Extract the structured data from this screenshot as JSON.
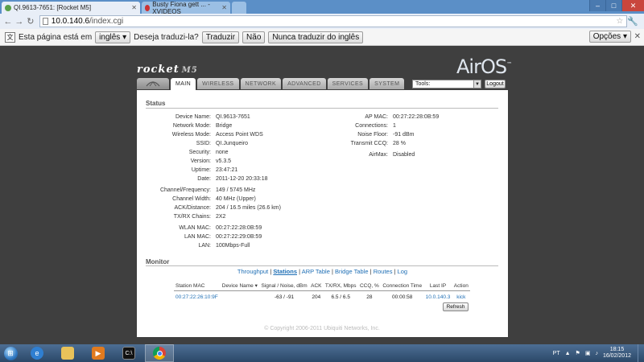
{
  "browser": {
    "tabs": [
      {
        "title": "QI.9613-7651: [Rocket M5]",
        "active": true
      },
      {
        "title": "Busty Fiona gett ... - XVIDEOS",
        "active": false
      }
    ],
    "url_host": "10.0.140.6",
    "url_path": "/index.cgi",
    "translate_bar": {
      "prefix": "Esta página está em",
      "language": "inglês",
      "question": "Deseja traduzi-la?",
      "translate": "Traduzir",
      "no": "Não",
      "never": "Nunca traduzir do inglês",
      "options": "Opções"
    }
  },
  "header": {
    "brand": "rocket",
    "model": "M5",
    "os_logo": "AirOS",
    "tabs": [
      "MAIN",
      "WIRELESS",
      "NETWORK",
      "ADVANCED",
      "SERVICES",
      "SYSTEM"
    ],
    "tools_label": "Tools:",
    "logout": "Logout"
  },
  "status": {
    "title": "Status",
    "left": [
      {
        "label": "Device Name:",
        "value": "QI.9613-7651"
      },
      {
        "label": "Network Mode:",
        "value": "Bridge"
      },
      {
        "label": "Wireless Mode:",
        "value": "Access Point WDS"
      },
      {
        "label": "SSID:",
        "value": "QI.Junqueiro"
      },
      {
        "label": "Security:",
        "value": "none"
      },
      {
        "label": "Version:",
        "value": "v5.3.5"
      },
      {
        "label": "Uptime:",
        "value": "23:47:21"
      },
      {
        "label": "Date:",
        "value": "2011-12-20 20:33:18"
      },
      {
        "label": "Channel/Frequency:",
        "value": "149 / 5745 MHz"
      },
      {
        "label": "Channel Width:",
        "value": "40 MHz (Upper)"
      },
      {
        "label": "ACK/Distance:",
        "value": "204 / 16.5 miles (26.6 km)"
      },
      {
        "label": "TX/RX Chains:",
        "value": "2X2"
      },
      {
        "label": "WLAN MAC:",
        "value": "00:27:22:28:0B:59"
      },
      {
        "label": "LAN MAC:",
        "value": "00:27:22:29:0B:59"
      },
      {
        "label": "LAN:",
        "value": "100Mbps-Full"
      }
    ],
    "right": [
      {
        "label": "AP MAC:",
        "value": "00:27:22:28:0B:59"
      },
      {
        "label": "Connections:",
        "value": "1"
      },
      {
        "label": "Noise Floor:",
        "value": "-91 dBm"
      },
      {
        "label": "Transmit CCQ:",
        "value": "28 %"
      },
      {
        "label": "AirMax:",
        "value": "Disabled"
      }
    ]
  },
  "monitor": {
    "title": "Monitor",
    "links": [
      "Throughput",
      "Stations",
      "ARP Table",
      "Bridge Table",
      "Routes",
      "Log"
    ],
    "table": {
      "headers": [
        "Station MAC",
        "Device Name",
        "Signal / Noise, dBm",
        "ACK",
        "TX/RX, Mbps",
        "CCQ, %",
        "Connection Time",
        "Last IP",
        "Action"
      ],
      "rows": [
        [
          "00:27:22:26:10:9F",
          "",
          "-63 / -91",
          "204",
          "6.5 / 6.5",
          "28",
          "00:00:58",
          "10.0.140.3",
          "kick"
        ]
      ]
    },
    "refresh": "Refresh"
  },
  "footer": {
    "copyright": "© Copyright 2006-2011 Ubiquiti Networks, Inc."
  },
  "taskbar": {
    "lang": "PT",
    "time": "18:15",
    "date": "16/02/2012"
  }
}
